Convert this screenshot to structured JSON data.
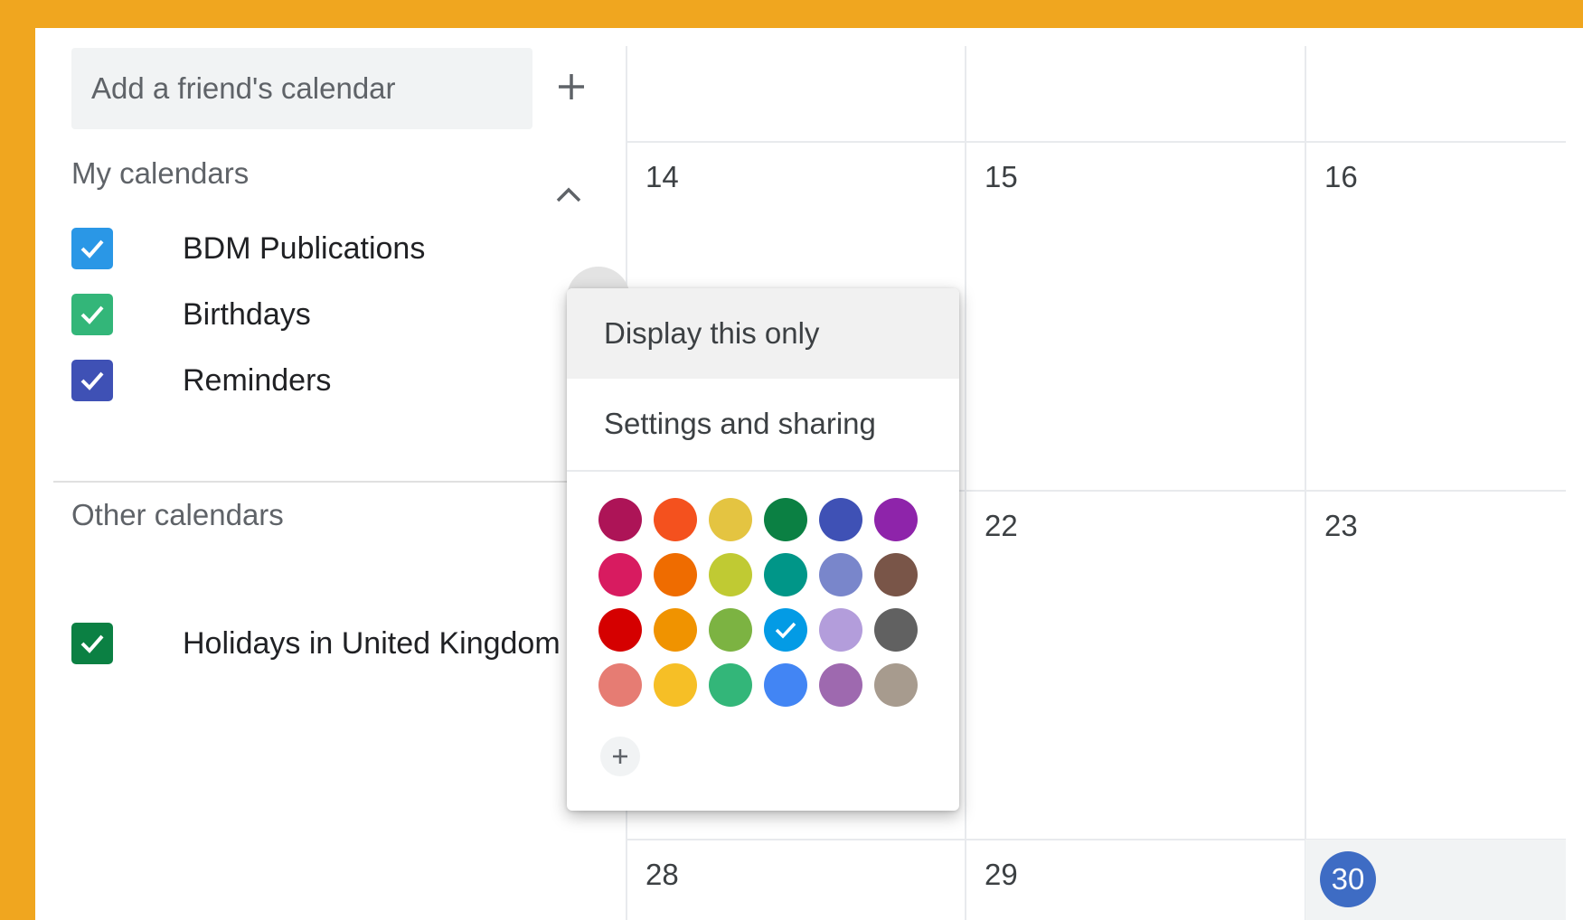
{
  "sidebar": {
    "add_friend_placeholder": "Add a friend's calendar",
    "my_calendars_title": "My calendars",
    "my_calendars": [
      {
        "label": "BDM Publications",
        "color": "#2A97E6"
      },
      {
        "label": "Birthdays",
        "color": "#33B679"
      },
      {
        "label": "Reminders",
        "color": "#3F51B5"
      }
    ],
    "other_calendars_title": "Other calendars",
    "other_calendars": [
      {
        "label": "Holidays in United Kingdom",
        "color": "#0B8043"
      }
    ]
  },
  "calendar_grid": {
    "days_row2": [
      "14",
      "15",
      "16"
    ],
    "days_row3": [
      "22",
      "23"
    ],
    "days_row4": [
      "28",
      "29"
    ],
    "today": "30",
    "today_color": "#3E6CC4"
  },
  "context_menu": {
    "display_this_only": "Display this only",
    "settings_and_sharing": "Settings and sharing",
    "selected_color": "#039BE5",
    "colors": [
      "#AD1457",
      "#F4511E",
      "#E4C441",
      "#0B8043",
      "#3F51B5",
      "#8E24AA",
      "#D81B60",
      "#EF6C00",
      "#C0CA33",
      "#009688",
      "#7986CB",
      "#795548",
      "#D50000",
      "#F09300",
      "#7CB342",
      "#039BE5",
      "#B39DDB",
      "#616161",
      "#E67C73",
      "#F6BF26",
      "#33B679",
      "#4285F4",
      "#9E69AF",
      "#A79B8E"
    ]
  }
}
